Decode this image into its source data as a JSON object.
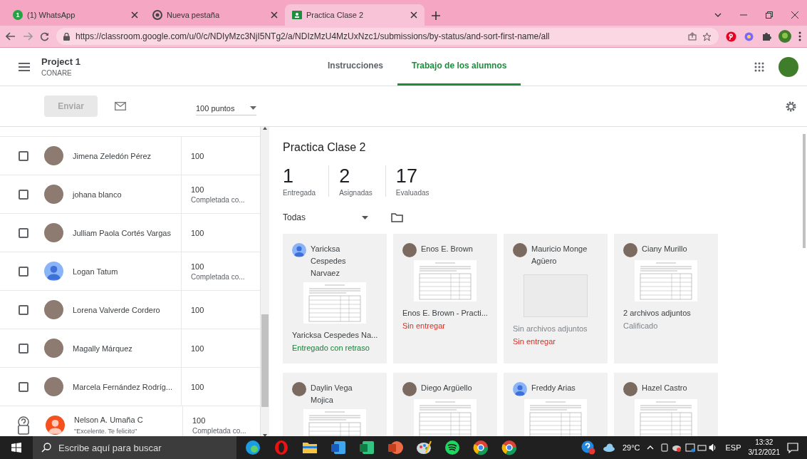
{
  "browser": {
    "tabs": [
      {
        "title": "(1) WhatsApp",
        "badge": "1",
        "selected": false
      },
      {
        "title": "Nueva pestaña",
        "selected": false
      },
      {
        "title": "Practica Clase 2",
        "selected": true
      }
    ],
    "url": "https://classroom.google.com/u/0/c/NDIyMzc3NjI5NTg2/a/NDIzMzU4MzUxNzc1/submissions/by-status/and-sort-first-name/all"
  },
  "header": {
    "title": "Project 1",
    "subtitle": "CONARE",
    "tabs": [
      {
        "label": "Instrucciones",
        "selected": false
      },
      {
        "label": "Trabajo de los alumnos",
        "selected": true
      }
    ]
  },
  "toolbar": {
    "send_button": {
      "label": "Enviar",
      "disabled": true
    },
    "points": "100 puntos"
  },
  "students": [
    {
      "kind": "checkbox",
      "checked": false,
      "avatar": {
        "kind": "photo"
      },
      "name": "Jimena Zeledón Pérez",
      "grade": "100"
    },
    {
      "kind": "checkbox",
      "checked": false,
      "avatar": {
        "kind": "photo"
      },
      "name": "johana blanco",
      "grade": "100",
      "note": "Completada co..."
    },
    {
      "kind": "checkbox",
      "checked": false,
      "avatar": {
        "kind": "photo"
      },
      "name": "Julliam Paola Cortés Vargas",
      "grade": "100"
    },
    {
      "kind": "checkbox",
      "checked": false,
      "avatar": {
        "kind": "default",
        "color": "#8ab4f8"
      },
      "name": "Logan Tatum",
      "grade": "100",
      "note": "Completada co..."
    },
    {
      "kind": "checkbox",
      "checked": false,
      "avatar": {
        "kind": "photo"
      },
      "name": "Lorena Valverde Cordero",
      "grade": "100"
    },
    {
      "kind": "checkbox",
      "checked": false,
      "avatar": {
        "kind": "photo"
      },
      "name": "Magally Márquez",
      "grade": "100"
    },
    {
      "kind": "checkbox",
      "checked": false,
      "avatar": {
        "kind": "photo"
      },
      "name": "Marcela Fernández Rodríg...",
      "grade": "100"
    },
    {
      "kind": "help",
      "checked": false,
      "avatar": {
        "kind": "default",
        "color": "#f4511e"
      },
      "name": "Nelson A. Umaña C",
      "comment": "\"Excelente. Te felicito\"",
      "grade": "100",
      "note": "Completada co..."
    }
  ],
  "assignment": {
    "title": "Practica Clase 2",
    "stats": [
      {
        "value": "1",
        "label": "Entregada"
      },
      {
        "value": "2",
        "label": "Asignadas"
      },
      {
        "value": "17",
        "label": "Evaluadas"
      }
    ],
    "filter": "Todas",
    "cards": [
      {
        "name": "Yaricksa Cespedes Narvaez",
        "avatar": {
          "kind": "default"
        },
        "thumbnail": {
          "kind": "document"
        },
        "file": "Yaricksa Cespedes Na...",
        "status": {
          "text": "Entregado con retraso",
          "kind": "late"
        }
      },
      {
        "name": "Enos E. Brown",
        "avatar": {
          "kind": "photo"
        },
        "thumbnail": {
          "kind": "document"
        },
        "file": "Enos E. Brown - Practi...",
        "status": {
          "text": "Sin entregar",
          "kind": "missing"
        }
      },
      {
        "name": "Mauricio Monge Agüero",
        "avatar": {
          "kind": "photo"
        },
        "thumbnail": {
          "kind": "empty"
        },
        "file": "Sin archivos adjuntos",
        "status": {
          "text": "Sin entregar",
          "kind": "missing"
        }
      },
      {
        "name": "Ciany Murillo",
        "avatar": {
          "kind": "photo"
        },
        "thumbnail": {
          "kind": "document"
        },
        "file": "2 archivos adjuntos",
        "status": {
          "text": "Calificado",
          "kind": "graded"
        }
      },
      {
        "name": "Daylin Vega Mojica",
        "avatar": {
          "kind": "photo"
        },
        "thumbnail": {
          "kind": "document"
        }
      },
      {
        "name": "Diego Argüello",
        "avatar": {
          "kind": "photo"
        },
        "thumbnail": {
          "kind": "document"
        }
      },
      {
        "name": "Freddy Arias",
        "avatar": {
          "kind": "default"
        },
        "thumbnail": {
          "kind": "document"
        }
      },
      {
        "name": "Hazel Castro",
        "avatar": {
          "kind": "photo"
        },
        "thumbnail": {
          "kind": "document"
        }
      }
    ]
  },
  "taskbar": {
    "search_placeholder": "Escribe aquí para buscar",
    "temperature": "29°C",
    "language": "ESP",
    "time": "13:32",
    "date": "3/12/2021"
  }
}
